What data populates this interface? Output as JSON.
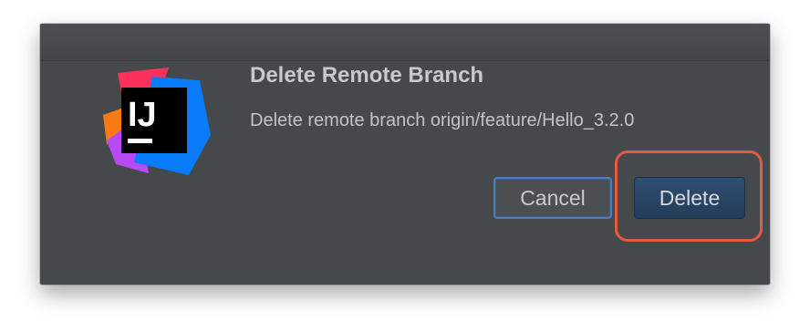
{
  "dialog": {
    "title": "Delete Remote Branch",
    "message": "Delete remote branch origin/feature/Hello_3.2.0",
    "logo": {
      "icon": "intellij-idea-logo-icon",
      "letters": "IJ"
    },
    "buttons": {
      "cancel_label": "Cancel",
      "delete_label": "Delete"
    }
  },
  "colors": {
    "dialog_background": "#46494b",
    "focus_ring": "#4a7fb8",
    "default_button": "#2f4e72",
    "annotation_highlight": "#e25a40"
  }
}
